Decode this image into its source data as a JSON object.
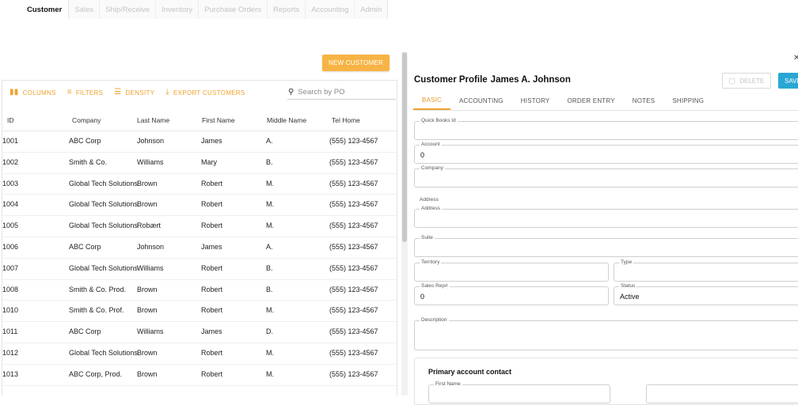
{
  "nav": {
    "tabs": [
      {
        "label": "Customer",
        "active": true
      },
      {
        "label": "Sales"
      },
      {
        "label": "Ship/Receive"
      },
      {
        "label": "Inventory"
      },
      {
        "label": "Purchase Orders"
      },
      {
        "label": "Reports"
      },
      {
        "label": "Accounting"
      },
      {
        "label": "Admin"
      }
    ]
  },
  "actions": {
    "new_customer": "NEW CUSTOMER"
  },
  "grid": {
    "toolbar": {
      "columns": "COLUMNS",
      "filters": "FILTERS",
      "density": "DENSITY",
      "export": "EXPORT CUSTOMERS"
    },
    "search_placeholder": "Search by PO",
    "headers": [
      "ID",
      "Company",
      "Last Name",
      "First Name",
      "Middle Name",
      "Tel Home"
    ],
    "rows": [
      [
        "1001",
        "ABC Corp",
        "Johnson",
        "James",
        "A.",
        "(555) 123-4567"
      ],
      [
        "1002",
        "Smith & Co.",
        "Williams",
        "Mary",
        "B.",
        "(555) 123-4567"
      ],
      [
        "1003",
        "Global Tech Solutions",
        "Brown",
        "Robert",
        "M.",
        "(555) 123-4567"
      ],
      [
        "1004",
        "Global Tech Solutions",
        "Brown",
        "Robert",
        "M.",
        "(555) 123-4567"
      ],
      [
        "1005",
        "Global Tech Solutions",
        "Robært",
        "Robert",
        "M.",
        "(555) 123-4567"
      ],
      [
        "1006",
        "ABC Corp",
        "Johnson",
        "James",
        "A.",
        "(555) 123-4567"
      ],
      [
        "1007",
        "Global Tech Solutions",
        "Williams",
        "Robert",
        "B.",
        "(555) 123-4567"
      ],
      [
        "1008",
        "Smith & Co. Prod.",
        "Brown",
        "Robert",
        "B.",
        "(555) 123-4567"
      ],
      [
        "1010",
        "Smith & Co. Prof.",
        "Brown",
        "Robert",
        "M.",
        "(555) 123-4567"
      ],
      [
        "1011",
        "ABC Corp",
        "Williams",
        "James",
        "D.",
        "(555) 123-4567"
      ],
      [
        "1012",
        "Global Tech Solutions",
        "Brown",
        "Robert",
        "M.",
        "(555) 123-4567"
      ],
      [
        "1013",
        "ABC Corp, Prod.",
        "Brown",
        "Robert",
        "M.",
        "(555) 123-4567"
      ]
    ]
  },
  "profile": {
    "title": "Customer Profile",
    "customer_name": "James A. Johnson",
    "delete_label": "DELETE",
    "save_label": "SAVE",
    "tabs": [
      "BASIC",
      "ACCOUNTING",
      "HISTORY",
      "ORDER ENTRY",
      "NOTES",
      "SHIPPING"
    ],
    "fields": {
      "quickbooks_id": {
        "label": "Quick Books Id",
        "value": ""
      },
      "account": {
        "label": "Account",
        "value": "0"
      },
      "company": {
        "label": "Company",
        "value": ""
      },
      "address_section": "Address",
      "address": {
        "label": "Address",
        "value": ""
      },
      "suite": {
        "label": "Suite",
        "value": ""
      },
      "territory": {
        "label": "Territory",
        "value": ""
      },
      "type": {
        "label": "Type",
        "value": ""
      },
      "sales_rep": {
        "label": "Sales Rep#",
        "value": "0"
      },
      "status": {
        "label": "Status",
        "value": "Active"
      },
      "description": {
        "label": "Description",
        "value": ""
      }
    },
    "contact": {
      "title": "Primary account contact",
      "first_name_label": "First Name"
    }
  }
}
